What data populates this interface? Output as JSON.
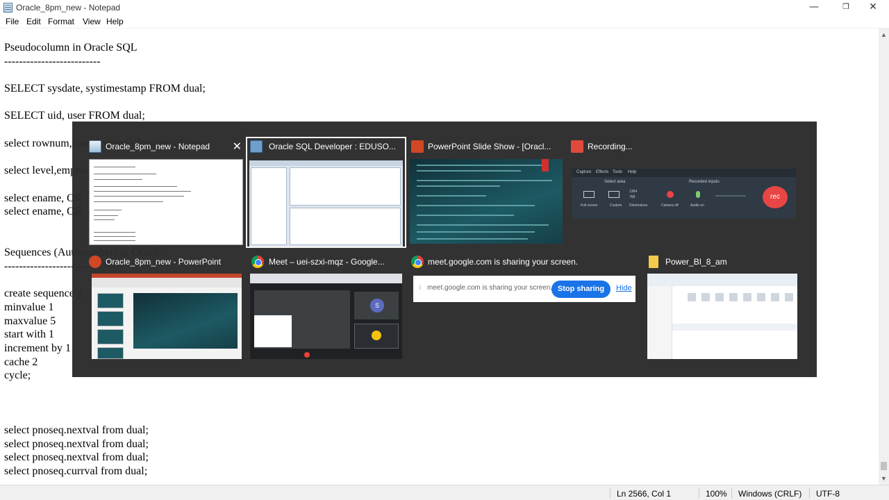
{
  "window": {
    "title": "Oracle_8pm_new - Notepad",
    "min_glyph": "—",
    "max_glyph": "❐",
    "close_glyph": "✕"
  },
  "menu": [
    "File",
    "Edit",
    "Format",
    "View",
    "Help"
  ],
  "editor_lines": [
    "Pseudocolumn in Oracle SQL",
    "--------------------------",
    "SELECT sysdate, systimestamp FROM dual;",
    "SELECT uid, user FROM dual;",
    "select rownum,rowid, empno from employee;",
    "select level,empno",
    "select ename, OR",
    "select ename, OR",
    "Sequences (Autonumber) in Oracle",
    "--------------------------------",
    "create sequence p",
    "minvalue 1",
    "maxvalue 5",
    "start with 1",
    "increment by 1",
    "cache 2",
    "cycle;",
    "select pnoseq.nextval from dual;",
    "select pnoseq.nextval from dual;",
    "select pnoseq.nextval from dual;",
    "select pnoseq.currval from dual;"
  ],
  "status": {
    "position": "Ln 2566, Col 1",
    "zoom": "100%",
    "line_ending": "Windows (CRLF)",
    "encoding": "UTF-8"
  },
  "switcher": {
    "close_glyph": "✕",
    "windows": [
      {
        "title": "Oracle_8pm_new - Notepad",
        "icon": "notepad-icon"
      },
      {
        "title": "Oracle SQL Developer : EDUSO...",
        "icon": "sql-developer-icon"
      },
      {
        "title": "PowerPoint Slide Show - [Oracl...",
        "icon": "powerpoint-icon"
      },
      {
        "title": "Recording...",
        "icon": "recorder-icon"
      },
      {
        "title": "Oracle_8pm_new - PowerPoint",
        "icon": "powerpoint-icon"
      },
      {
        "title": "Meet – uei-szxi-mqz - Google...",
        "icon": "chrome-icon"
      },
      {
        "title": "meet.google.com is sharing your screen.",
        "icon": "chrome-icon"
      },
      {
        "title": "Power_BI_8_am",
        "icon": "folder-icon"
      }
    ],
    "recording_panel": {
      "tabs": [
        "Capture",
        "Effects",
        "Tools",
        "Help"
      ],
      "select_area_label": "Select area",
      "recorded_inputs_label": "Recorded inputs",
      "full_screen": "Full screen",
      "custom": "Custom",
      "dimensions": "Dimensions",
      "width": "1364",
      "height": "768",
      "camera": "Camera off",
      "audio": "Audio on",
      "rec": "rec"
    },
    "share_bar": {
      "text": "meet.google.com is sharing your screen.",
      "stop": "Stop sharing",
      "hide": "Hide"
    }
  },
  "colors": {
    "overlay": "#2b2b2b",
    "accent_blue": "#1a73e8",
    "rec_red": "#e84545",
    "ppt_orange": "#d24726"
  }
}
